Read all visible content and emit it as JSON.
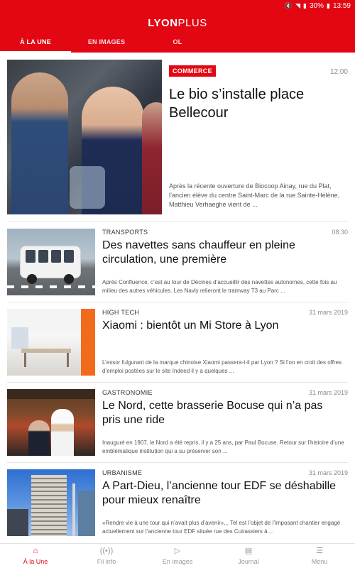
{
  "status_bar": {
    "battery": "30%",
    "time": "13:59"
  },
  "app": {
    "logo_bold": "LYON",
    "logo_light": "PLUS",
    "accent": "#e30613"
  },
  "tabs": [
    {
      "label": "À LA UNE",
      "active": true
    },
    {
      "label": "EN IMAGES",
      "active": false
    },
    {
      "label": "OL",
      "active": false
    }
  ],
  "hero": {
    "category": "COMMERCE",
    "time": "12:00",
    "title": "Le bio s’installe place Bellecour",
    "excerpt": "Après la récente ouverture de Biocoop Ainay, rue du Plat, l’ancien élève du centre Saint-Marc de la rue Sainte-Hélène, Matthieu Verhaeghe vient de ..."
  },
  "articles": [
    {
      "category": "TRANSPORTS",
      "date": "08:30",
      "title": "Des navettes sans chauffeur en pleine circulation, une première",
      "excerpt": "Après Confluence, c’est au tour de Décines d’accueillir des navettes autonomes, cette fois au milieu des autres véhicules. Les Navly relieront le tramway T3 au Parc ..."
    },
    {
      "category": "HIGH TECH",
      "date": "31 mars 2019",
      "title": "Xiaomi : bientôt un Mi Store à Lyon",
      "excerpt": "L’essor fulgurant de la marque chinoise Xiaomi passera-t-il par Lyon ? Si l’on en croit des offres d’emploi postées sur le site Indeed il y a quelques ..."
    },
    {
      "category": "GASTRONOMIE",
      "date": "31 mars 2019",
      "title": "Le Nord, cette brasserie Bocuse qui n’a pas pris une ride",
      "excerpt": "Inauguré en 1907, le Nord a été repris, il y a 25 ans, par Paul Bocuse. Retour sur l’histoire d’une emblématique institution qui a su préserver son ..."
    },
    {
      "category": "URBANISME",
      "date": "31 mars 2019",
      "title": "A Part-Dieu, l’ancienne tour EDF se déshabille pour mieux renaître",
      "excerpt": "«Rendre vie à une tour qui n’avait plus d’avenir»... Tel est l’objet de l’imposant chantier engagé actuellement sur l’ancienne tour EDF située rue des Cuirassiers à ..."
    }
  ],
  "bottom_nav": [
    {
      "label": "À la Une",
      "icon": "home-icon",
      "active": true
    },
    {
      "label": "Fil info",
      "icon": "live-icon",
      "active": false
    },
    {
      "label": "En images",
      "icon": "play-icon",
      "active": false
    },
    {
      "label": "Journal",
      "icon": "newspaper-icon",
      "active": false
    },
    {
      "label": "Menu",
      "icon": "menu-icon",
      "active": false
    }
  ]
}
